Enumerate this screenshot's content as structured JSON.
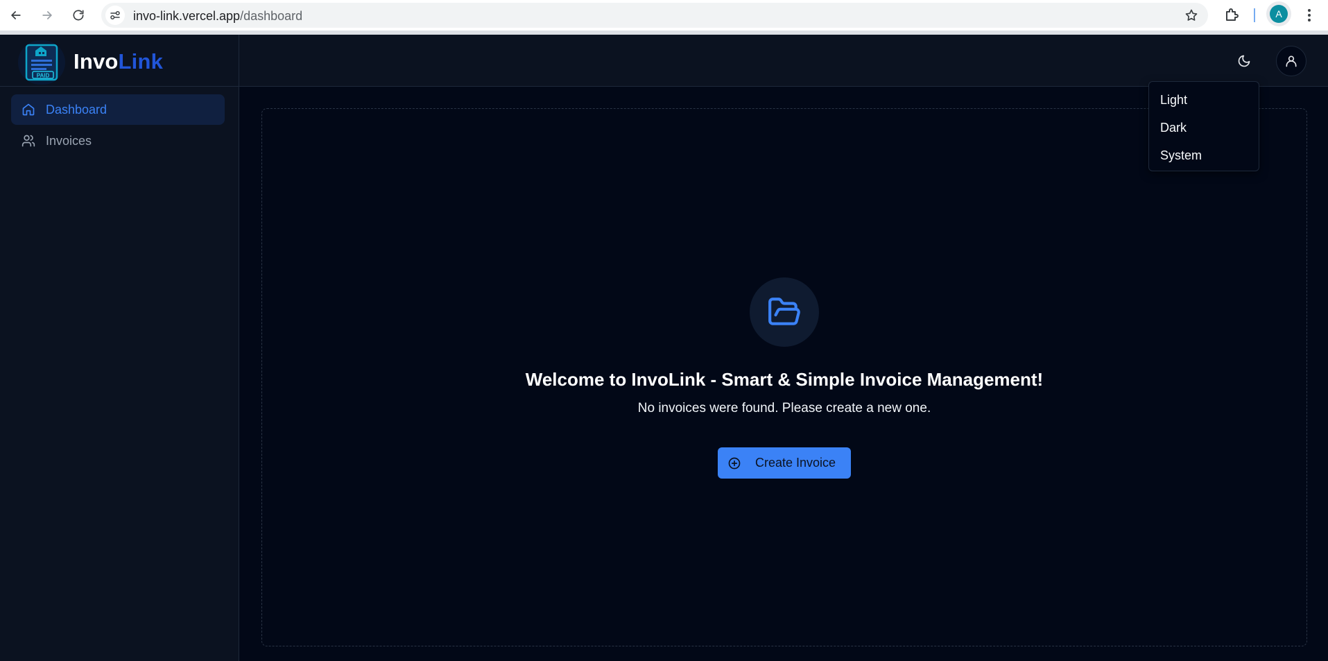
{
  "browser": {
    "url_host": "invo-link.vercel.app",
    "url_path": "/dashboard",
    "profile_initial": "A",
    "icons": [
      "back-icon",
      "forward-icon",
      "reload-icon",
      "site-info-icon",
      "star-icon",
      "extensions-icon",
      "more-icon"
    ]
  },
  "app": {
    "logo_text_main": "Invo",
    "logo_text_accent": "Link",
    "logo_badge_text": "PAID"
  },
  "sidebar": {
    "items": [
      {
        "label": "Dashboard",
        "icon": "home-icon",
        "active": true
      },
      {
        "label": "Invoices",
        "icon": "users-icon",
        "active": false
      }
    ]
  },
  "header": {
    "theme_icon": "moon-icon",
    "user_icon": "user-icon"
  },
  "theme_menu": {
    "options": [
      "Light",
      "Dark",
      "System"
    ]
  },
  "empty_state": {
    "icon": "folder-open-icon",
    "title": "Welcome to InvoLink - Smart & Simple Invoice Management!",
    "subtitle": "No invoices were found. Please create a new one.",
    "button_label": "Create Invoice",
    "button_icon": "plus-circle-icon"
  },
  "colors": {
    "accent": "#3b82f6",
    "logo_accent": "#2155d8",
    "background": "#020817",
    "panel": "#0b1220"
  }
}
